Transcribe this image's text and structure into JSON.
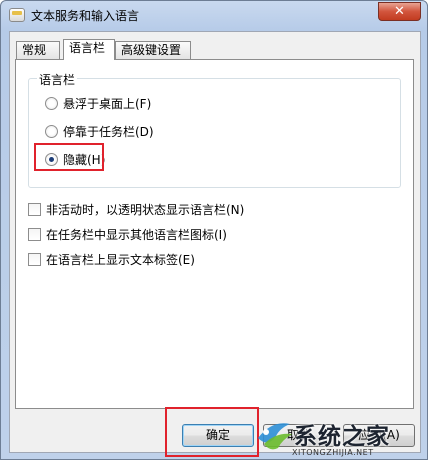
{
  "window": {
    "title": "文本服务和输入语言",
    "close_glyph": "✕"
  },
  "tabs": [
    {
      "label": "常规"
    },
    {
      "label": "语言栏"
    },
    {
      "label": "高级键设置"
    }
  ],
  "active_tab": "语言栏",
  "language_bar": {
    "group_label": "语言栏",
    "options": [
      {
        "label": "悬浮于桌面上(F)",
        "checked": false
      },
      {
        "label": "停靠于任务栏(D)",
        "checked": false
      },
      {
        "label": "隐藏(H)",
        "checked": true
      }
    ],
    "checkboxes": [
      {
        "label": "非活动时，以透明状态显示语言栏(N)",
        "checked": false
      },
      {
        "label": "在任务栏中显示其他语言栏图标(I)",
        "checked": false
      },
      {
        "label": "在语言栏上显示文本标签(E)",
        "checked": false
      }
    ]
  },
  "buttons": {
    "ok": "确定",
    "cancel": "取消",
    "apply": "应用(A)"
  },
  "watermark": {
    "name": "系统之家",
    "url": "XITONGZHIJIA.NET"
  },
  "colors": {
    "highlight": "#e0222c",
    "title_bar": "#b6cbe8"
  }
}
